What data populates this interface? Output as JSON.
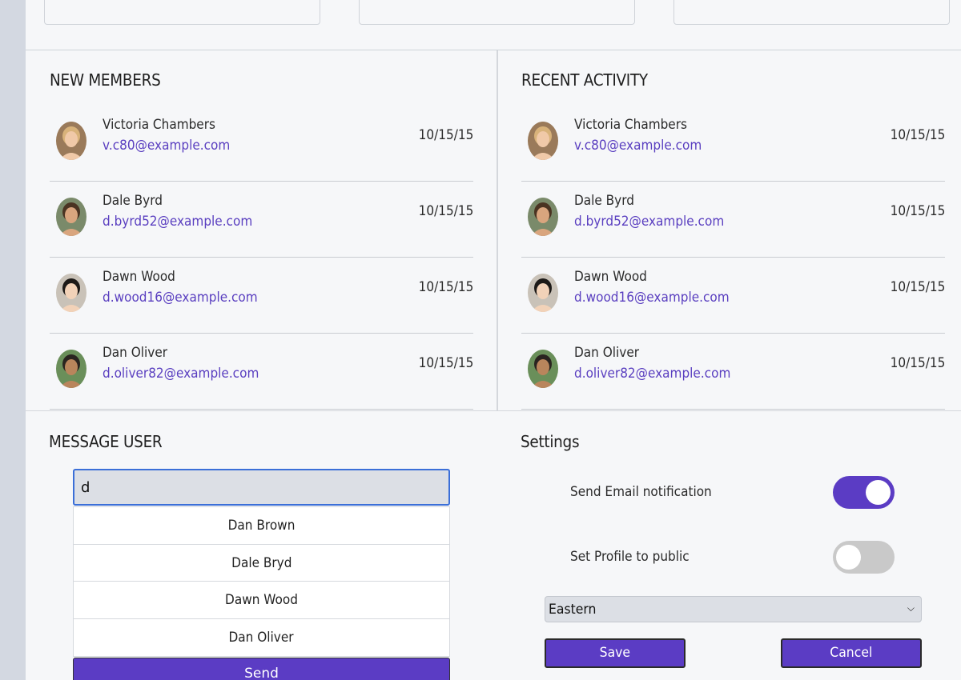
{
  "new_members": {
    "title": "NEW MEMBERS",
    "items": [
      {
        "name": "Victoria Chambers",
        "email": "v.c80@example.com",
        "date": "10/15/15"
      },
      {
        "name": "Dale Byrd",
        "email": "d.byrd52@example.com",
        "date": "10/15/15"
      },
      {
        "name": "Dawn Wood",
        "email": "d.wood16@example.com",
        "date": "10/15/15"
      },
      {
        "name": "Dan Oliver",
        "email": "d.oliver82@example.com",
        "date": "10/15/15"
      }
    ]
  },
  "recent_activity": {
    "title": "RECENT ACTIVITY",
    "items": [
      {
        "name": "Victoria Chambers",
        "email": "v.c80@example.com",
        "date": "10/15/15"
      },
      {
        "name": "Dale Byrd",
        "email": "d.byrd52@example.com",
        "date": "10/15/15"
      },
      {
        "name": "Dawn Wood",
        "email": "d.wood16@example.com",
        "date": "10/15/15"
      },
      {
        "name": "Dan Oliver",
        "email": "d.oliver82@example.com",
        "date": "10/15/15"
      }
    ]
  },
  "message_user": {
    "title": "MESSAGE USER",
    "input_value": "d",
    "suggestions": [
      "Dan Brown",
      "Dale Bryd",
      "Dawn Wood",
      "Dan Oliver"
    ],
    "send_label": "Send"
  },
  "settings": {
    "title": "Settings",
    "email_notification_label": "Send Email notification",
    "email_notification_on": true,
    "public_profile_label": "Set Profile to public",
    "public_profile_on": false,
    "timezone_selected": "Eastern",
    "save_label": "Save",
    "cancel_label": "Cancel"
  },
  "colors": {
    "accent": "#5b3cc4",
    "link": "#5a3fc0",
    "toggle_off": "#c9c9c9",
    "rail": "#d3d8e1"
  },
  "icons": {
    "avatar": "user-avatar-photo",
    "select_caret": "chevron-down-icon"
  }
}
